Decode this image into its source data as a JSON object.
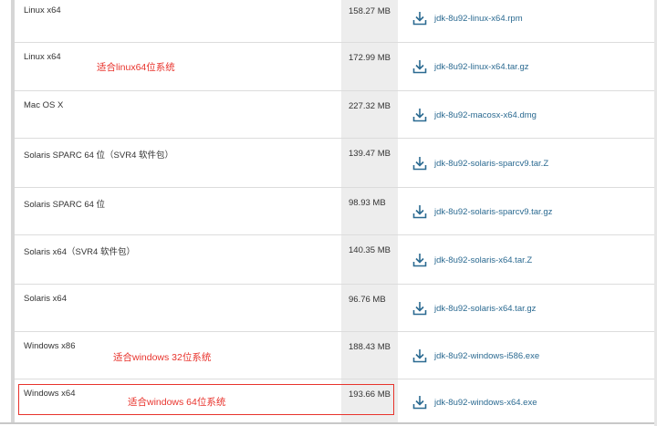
{
  "rows": [
    {
      "os": "Linux x64",
      "size": "158.27 MB",
      "file": "jdk-8u92-linux-x64.rpm"
    },
    {
      "os": "Linux x64",
      "size": "172.99 MB",
      "file": "jdk-8u92-linux-x64.tar.gz"
    },
    {
      "os": "Mac OS X",
      "size": "227.32 MB",
      "file": "jdk-8u92-macosx-x64.dmg"
    },
    {
      "os": "Solaris SPARC 64 位（SVR4 软件包）",
      "size": "139.47 MB",
      "file": "jdk-8u92-solaris-sparcv9.tar.Z"
    },
    {
      "os": "Solaris SPARC 64 位",
      "size": "98.93 MB",
      "file": "jdk-8u92-solaris-sparcv9.tar.gz"
    },
    {
      "os": "Solaris x64（SVR4 软件包）",
      "size": "140.35 MB",
      "file": "jdk-8u92-solaris-x64.tar.Z"
    },
    {
      "os": "Solaris x64",
      "size": "96.76 MB",
      "file": "jdk-8u92-solaris-x64.tar.gz"
    },
    {
      "os": "Windows x86",
      "size": "188.43 MB",
      "file": "jdk-8u92-windows-i586.exe"
    },
    {
      "os": "Windows x64",
      "size": "193.66 MB",
      "file": "jdk-8u92-windows-x64.exe"
    }
  ],
  "annotations": {
    "linux64": "适合linux64位系统",
    "win32": "适合windows 32位系统",
    "win64": "适合windows 64位系统"
  },
  "colors": {
    "link": "#2b6a91",
    "annotation": "#e8332c",
    "size_column_bg": "#ededed"
  },
  "icons": {
    "download": "download-icon"
  }
}
